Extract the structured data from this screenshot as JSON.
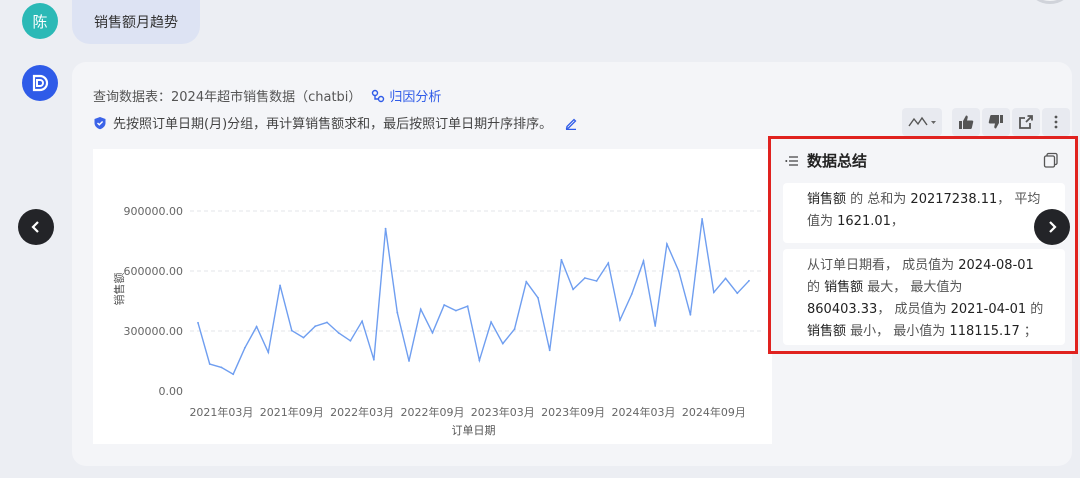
{
  "user": {
    "avatar_text": "陈",
    "message": "销售额月趋势"
  },
  "answer": {
    "query_prefix": "查询数据表：",
    "query_table": "2024年超市销售数据（chatbi）",
    "attribution_link": "归因分析",
    "description": "先按照订单日期(月)分组，再计算销售额求和，最后按照订单日期升序排序。"
  },
  "toolbar": {
    "chart_type_icon": "line-chart-icon",
    "like_icon": "thumbs-up-icon",
    "dislike_icon": "thumbs-down-icon",
    "share_icon": "share-icon",
    "more_icon": "more-icon"
  },
  "summary": {
    "title": "数据总结",
    "block1": {
      "p1": "销售额",
      "p2": " 的 总和为 ",
      "p3": "20217238.11",
      "p4": "， 平均值为 ",
      "p5": "1621.01",
      "p6": "，"
    },
    "block2": {
      "p1": "从订单日期看， 成员值为 ",
      "p2": "2024-08-01",
      "p3": " 的 ",
      "p4": "销售额",
      "p5": " 最大， 最大值为 ",
      "p6": "860403.33",
      "p7": "， 成员值为 ",
      "p8": "2021-04-01",
      "p9": " 的 ",
      "p10": "销售额",
      "p11": " 最小， 最小值为 ",
      "p12": "118115.17",
      "p13": " ；"
    }
  },
  "colors": {
    "accent": "#2f5be8",
    "line": "#6f9ef0",
    "highlight_border": "#e0221f"
  },
  "chart_data": {
    "type": "line",
    "xlabel": "订单日期",
    "ylabel": "销售额",
    "ylim": [
      0,
      900000
    ],
    "yticks": [
      "900000.00",
      "600000.00",
      "300000.00",
      "0.00"
    ],
    "ytick_values": [
      900000,
      600000,
      300000,
      0
    ],
    "xtick_labels": [
      "2021年03月",
      "2021年09月",
      "2022年03月",
      "2022年09月",
      "2023年03月",
      "2023年09月",
      "2024年03月",
      "2024年09月"
    ],
    "xtick_index": [
      2,
      8,
      14,
      20,
      26,
      32,
      38,
      44
    ],
    "series": [
      {
        "values": [
          341000,
          135000,
          118115,
          84000,
          216000,
          322000,
          193000,
          528000,
          302000,
          267000,
          324000,
          343000,
          290000,
          251000,
          349000,
          156000,
          812000,
          392000,
          150000,
          409000,
          291000,
          430000,
          402000,
          424000,
          153000,
          345000,
          237000,
          309000,
          546000,
          466000,
          203000,
          656000,
          508000,
          565000,
          550000,
          640000,
          355000,
          485000,
          650000,
          325000,
          735000,
          600000,
          381000,
          860403,
          493000,
          563000,
          489000,
          551000
        ]
      }
    ],
    "grid": "horizontal-dashed"
  }
}
